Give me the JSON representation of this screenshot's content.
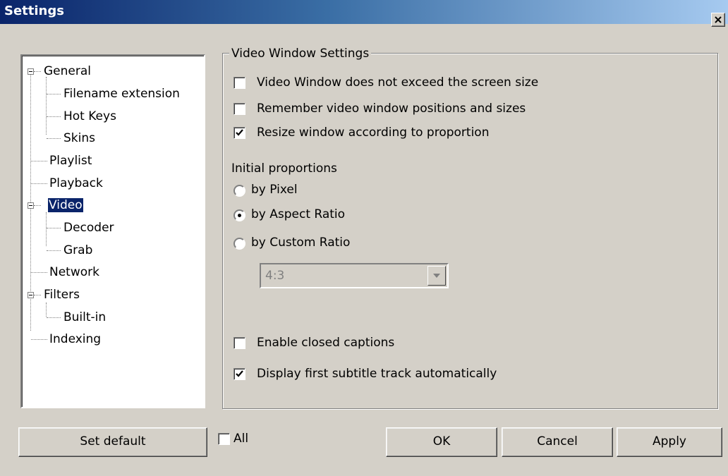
{
  "window": {
    "title": "Settings"
  },
  "tree": {
    "items": [
      {
        "label": "General"
      },
      {
        "label": "Filename extension"
      },
      {
        "label": "Hot Keys"
      },
      {
        "label": "Skins"
      },
      {
        "label": "Playlist"
      },
      {
        "label": "Playback"
      },
      {
        "label": "Video",
        "selected": true
      },
      {
        "label": "Decoder"
      },
      {
        "label": "Grab"
      },
      {
        "label": "Network"
      },
      {
        "label": "Filters"
      },
      {
        "label": "Built-in"
      },
      {
        "label": "Indexing"
      }
    ]
  },
  "video_settings": {
    "group_title": "Video Window Settings",
    "options": [
      {
        "label": "Video Window does not exceed the screen size",
        "checked": false
      },
      {
        "label": "Remember video window positions and sizes",
        "checked": false
      },
      {
        "label": "Resize window according to proportion",
        "checked": true
      }
    ],
    "initial_proportions": {
      "label": "Initial proportions",
      "radios": [
        {
          "label": "by Pixel",
          "selected": false
        },
        {
          "label": "by Aspect Ratio",
          "selected": true
        },
        {
          "label": "by Custom Ratio",
          "selected": false
        }
      ],
      "custom_ratio_value": "4:3"
    },
    "captions": [
      {
        "label": "Enable closed captions",
        "checked": false
      },
      {
        "label": "Display first subtitle track automatically",
        "checked": true
      }
    ]
  },
  "footer": {
    "set_default": "Set default",
    "all_label": "All",
    "all_checked": false,
    "ok": "OK",
    "cancel": "Cancel",
    "apply": "Apply"
  }
}
